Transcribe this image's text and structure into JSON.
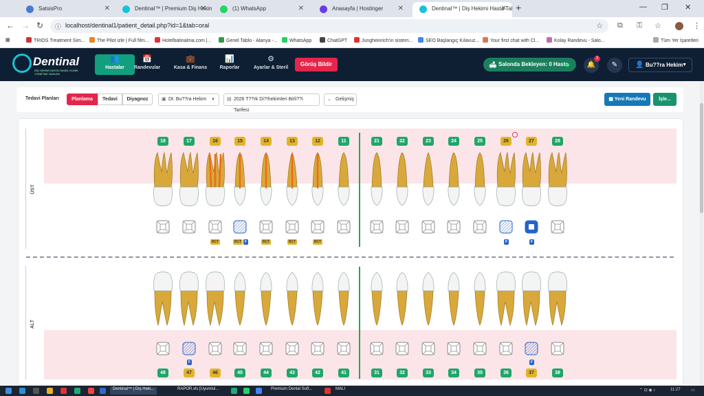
{
  "browser": {
    "tabs": [
      {
        "label": "SatsisPro",
        "favicon_color": "#4a7bd0"
      },
      {
        "label": "Dentinal™ | Premium Diş Hekimi Ki",
        "favicon_color": "#19c2d6"
      },
      {
        "label": "(1) WhatsApp",
        "favicon_color": "#25d366"
      },
      {
        "label": "Anasayfa | Hostinger",
        "favicon_color": "#673de6"
      },
      {
        "label": "Dentinal™ | Diş Hekimi Hasta Takip",
        "favicon_color": "#19c2d6"
      }
    ],
    "url": "localhost/dentinal1/patient_detail.php?id=1&tab=oral",
    "bookmarks": [
      "TRIOS Treatment Sim...",
      "The Pilot izle | Full film...",
      "Hotelbatinalma.com |...",
      "Genel Tablo - Alanya -...",
      "WhatsApp",
      "ChatGPT",
      "Jungheinrich'in sistem...",
      "SEO Başlangıç Kılavuz...",
      "Your first chat with Cl...",
      "Kolay Randevu - Salo..."
    ],
    "bookmarks_right": "Tüm Yer İşaretleri"
  },
  "app": {
    "brand": "Dentinal",
    "brand_tagline": "DİŞ HEKİMİ HASTA TAKİBİ, KLİNİK YÖNETİMİ YAZILIMI",
    "nav": [
      {
        "label": "Hastalar",
        "icon": "users-icon",
        "glyph": "👥",
        "active": true
      },
      {
        "label": "Randevular",
        "icon": "calendar-icon",
        "glyph": "📅",
        "active": false
      },
      {
        "label": "Kasa & Finans",
        "icon": "wallet-icon",
        "glyph": "💼",
        "active": false
      },
      {
        "label": "Raporlar",
        "icon": "chart-icon",
        "glyph": "📊",
        "active": false
      },
      {
        "label": "Ayarlar & Steril",
        "icon": "gears-icon",
        "glyph": "⚙",
        "active": false
      }
    ],
    "feedback": "Görüş Bildir",
    "waiting": "Salonda Bekleyen: 0 Hasta",
    "notif_count": "3",
    "user": "Bu??ra Hekim"
  },
  "plans": {
    "label": "Tedavi Planları",
    "segments": [
      "Planlama",
      "Tedavi",
      "Diyagnoz"
    ],
    "doctor": "Dt. Bu??ra Hekim",
    "tariff": "2026 T??rk Di?!hekimleri Birli??i Tarifesi",
    "advanced": "Gelişmiş",
    "new_appointment": "Yeni Randevu",
    "action": "İşle..."
  },
  "chart": {
    "upper_label": "ÜST",
    "lower_label": "ALT",
    "upper": [
      {
        "n": "18",
        "c": "g"
      },
      {
        "n": "17",
        "c": "g"
      },
      {
        "n": "16",
        "c": "y",
        "rct": true
      },
      {
        "n": "15",
        "c": "y",
        "rct": true,
        "f": true
      },
      {
        "n": "14",
        "c": "y",
        "rct": true
      },
      {
        "n": "13",
        "c": "y",
        "rct": true
      },
      {
        "n": "12",
        "c": "y",
        "rct": true
      },
      {
        "n": "11",
        "c": "g"
      },
      {
        "n": "21",
        "c": "g"
      },
      {
        "n": "22",
        "c": "g"
      },
      {
        "n": "23",
        "c": "g"
      },
      {
        "n": "24",
        "c": "g"
      },
      {
        "n": "25",
        "c": "g"
      },
      {
        "n": "26",
        "c": "y",
        "f": true,
        "alert": true
      },
      {
        "n": "27",
        "c": "y",
        "f": true
      },
      {
        "n": "28",
        "c": "g"
      }
    ],
    "lower": [
      {
        "n": "48",
        "c": "g"
      },
      {
        "n": "47",
        "c": "y",
        "f": true
      },
      {
        "n": "46",
        "c": "y"
      },
      {
        "n": "45",
        "c": "g"
      },
      {
        "n": "44",
        "c": "g"
      },
      {
        "n": "43",
        "c": "g"
      },
      {
        "n": "42",
        "c": "g"
      },
      {
        "n": "41",
        "c": "g"
      },
      {
        "n": "31",
        "c": "g"
      },
      {
        "n": "32",
        "c": "g"
      },
      {
        "n": "33",
        "c": "g"
      },
      {
        "n": "34",
        "c": "g"
      },
      {
        "n": "35",
        "c": "g"
      },
      {
        "n": "36",
        "c": "g"
      },
      {
        "n": "37",
        "c": "y",
        "f": true
      },
      {
        "n": "38",
        "c": "g"
      }
    ],
    "badge_rct": "RCT",
    "badge_f": "F"
  },
  "taskbar": {
    "items": [
      "Dentinal™ | Diş Heki...",
      "RAPOR.xls [Uyumlul...",
      "Premium Dental Soft...",
      "MALI"
    ],
    "clock": "11:27"
  }
}
